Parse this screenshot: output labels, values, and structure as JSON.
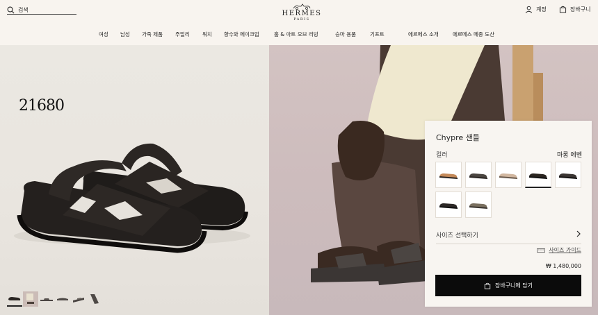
{
  "header": {
    "search_placeholder": "검색",
    "logo_name": "HERMES",
    "logo_city": "PARIS",
    "account_label": "계정",
    "cart_label": "장바구니"
  },
  "nav": {
    "items": [
      "여성",
      "남성",
      "가죽 제품",
      "주얼리",
      "워치",
      "향수와 메이크업",
      "홈 & 아트 오브 리빙",
      "승마 용품",
      "기프트",
      "에르메스 소개",
      "에르메스 메종 도산"
    ]
  },
  "gallery": {
    "watermark": "21680",
    "thumbnail_count": 7,
    "active_thumbnail": 1
  },
  "product": {
    "title": "Chypre 샌들",
    "color_label": "컬러",
    "color_value": "마롱 에벤",
    "swatch_colors": [
      "#c48a5a",
      "#4a4540",
      "#d1b7a0",
      "#2a2520",
      "#3a3532",
      "#2c2826",
      "#7a7060"
    ],
    "selected_swatch": 4,
    "size_label": "사이즈 선택하기",
    "size_guide_label": "사이즈 가이드",
    "price": "₩ 1,480,000",
    "add_to_cart_label": "장바구니에 담기"
  },
  "colors": {
    "button_bg": "#0b0b0b",
    "card_bg": "#f8f5f1",
    "header_bg": "#f8f4ef"
  }
}
